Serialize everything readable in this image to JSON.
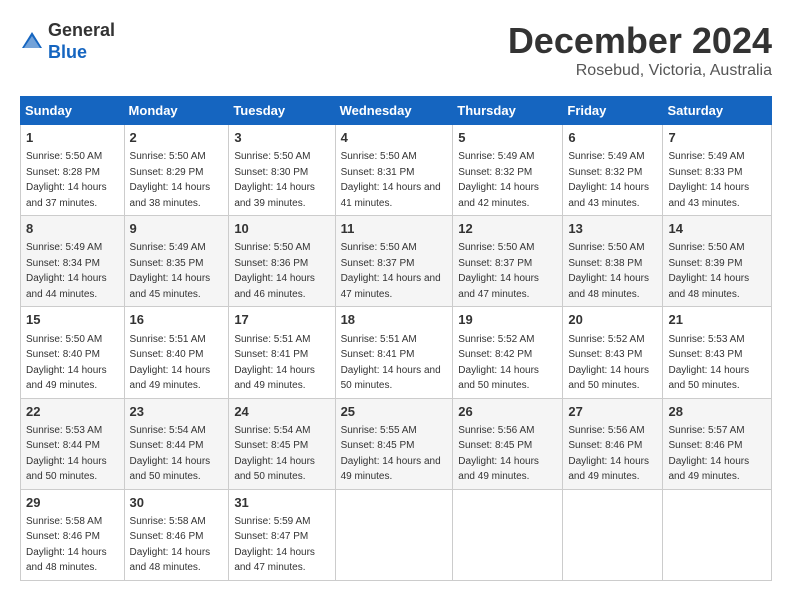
{
  "header": {
    "logo_general": "General",
    "logo_blue": "Blue",
    "month_title": "December 2024",
    "location": "Rosebud, Victoria, Australia"
  },
  "days_of_week": [
    "Sunday",
    "Monday",
    "Tuesday",
    "Wednesday",
    "Thursday",
    "Friday",
    "Saturday"
  ],
  "weeks": [
    [
      {
        "day": "1",
        "sunrise": "5:50 AM",
        "sunset": "8:28 PM",
        "daylight": "14 hours and 37 minutes."
      },
      {
        "day": "2",
        "sunrise": "5:50 AM",
        "sunset": "8:29 PM",
        "daylight": "14 hours and 38 minutes."
      },
      {
        "day": "3",
        "sunrise": "5:50 AM",
        "sunset": "8:30 PM",
        "daylight": "14 hours and 39 minutes."
      },
      {
        "day": "4",
        "sunrise": "5:50 AM",
        "sunset": "8:31 PM",
        "daylight": "14 hours and 41 minutes."
      },
      {
        "day": "5",
        "sunrise": "5:49 AM",
        "sunset": "8:32 PM",
        "daylight": "14 hours and 42 minutes."
      },
      {
        "day": "6",
        "sunrise": "5:49 AM",
        "sunset": "8:32 PM",
        "daylight": "14 hours and 43 minutes."
      },
      {
        "day": "7",
        "sunrise": "5:49 AM",
        "sunset": "8:33 PM",
        "daylight": "14 hours and 43 minutes."
      }
    ],
    [
      {
        "day": "8",
        "sunrise": "5:49 AM",
        "sunset": "8:34 PM",
        "daylight": "14 hours and 44 minutes."
      },
      {
        "day": "9",
        "sunrise": "5:49 AM",
        "sunset": "8:35 PM",
        "daylight": "14 hours and 45 minutes."
      },
      {
        "day": "10",
        "sunrise": "5:50 AM",
        "sunset": "8:36 PM",
        "daylight": "14 hours and 46 minutes."
      },
      {
        "day": "11",
        "sunrise": "5:50 AM",
        "sunset": "8:37 PM",
        "daylight": "14 hours and 47 minutes."
      },
      {
        "day": "12",
        "sunrise": "5:50 AM",
        "sunset": "8:37 PM",
        "daylight": "14 hours and 47 minutes."
      },
      {
        "day": "13",
        "sunrise": "5:50 AM",
        "sunset": "8:38 PM",
        "daylight": "14 hours and 48 minutes."
      },
      {
        "day": "14",
        "sunrise": "5:50 AM",
        "sunset": "8:39 PM",
        "daylight": "14 hours and 48 minutes."
      }
    ],
    [
      {
        "day": "15",
        "sunrise": "5:50 AM",
        "sunset": "8:40 PM",
        "daylight": "14 hours and 49 minutes."
      },
      {
        "day": "16",
        "sunrise": "5:51 AM",
        "sunset": "8:40 PM",
        "daylight": "14 hours and 49 minutes."
      },
      {
        "day": "17",
        "sunrise": "5:51 AM",
        "sunset": "8:41 PM",
        "daylight": "14 hours and 49 minutes."
      },
      {
        "day": "18",
        "sunrise": "5:51 AM",
        "sunset": "8:41 PM",
        "daylight": "14 hours and 50 minutes."
      },
      {
        "day": "19",
        "sunrise": "5:52 AM",
        "sunset": "8:42 PM",
        "daylight": "14 hours and 50 minutes."
      },
      {
        "day": "20",
        "sunrise": "5:52 AM",
        "sunset": "8:43 PM",
        "daylight": "14 hours and 50 minutes."
      },
      {
        "day": "21",
        "sunrise": "5:53 AM",
        "sunset": "8:43 PM",
        "daylight": "14 hours and 50 minutes."
      }
    ],
    [
      {
        "day": "22",
        "sunrise": "5:53 AM",
        "sunset": "8:44 PM",
        "daylight": "14 hours and 50 minutes."
      },
      {
        "day": "23",
        "sunrise": "5:54 AM",
        "sunset": "8:44 PM",
        "daylight": "14 hours and 50 minutes."
      },
      {
        "day": "24",
        "sunrise": "5:54 AM",
        "sunset": "8:45 PM",
        "daylight": "14 hours and 50 minutes."
      },
      {
        "day": "25",
        "sunrise": "5:55 AM",
        "sunset": "8:45 PM",
        "daylight": "14 hours and 49 minutes."
      },
      {
        "day": "26",
        "sunrise": "5:56 AM",
        "sunset": "8:45 PM",
        "daylight": "14 hours and 49 minutes."
      },
      {
        "day": "27",
        "sunrise": "5:56 AM",
        "sunset": "8:46 PM",
        "daylight": "14 hours and 49 minutes."
      },
      {
        "day": "28",
        "sunrise": "5:57 AM",
        "sunset": "8:46 PM",
        "daylight": "14 hours and 49 minutes."
      }
    ],
    [
      {
        "day": "29",
        "sunrise": "5:58 AM",
        "sunset": "8:46 PM",
        "daylight": "14 hours and 48 minutes."
      },
      {
        "day": "30",
        "sunrise": "5:58 AM",
        "sunset": "8:46 PM",
        "daylight": "14 hours and 48 minutes."
      },
      {
        "day": "31",
        "sunrise": "5:59 AM",
        "sunset": "8:47 PM",
        "daylight": "14 hours and 47 minutes."
      },
      null,
      null,
      null,
      null
    ]
  ]
}
